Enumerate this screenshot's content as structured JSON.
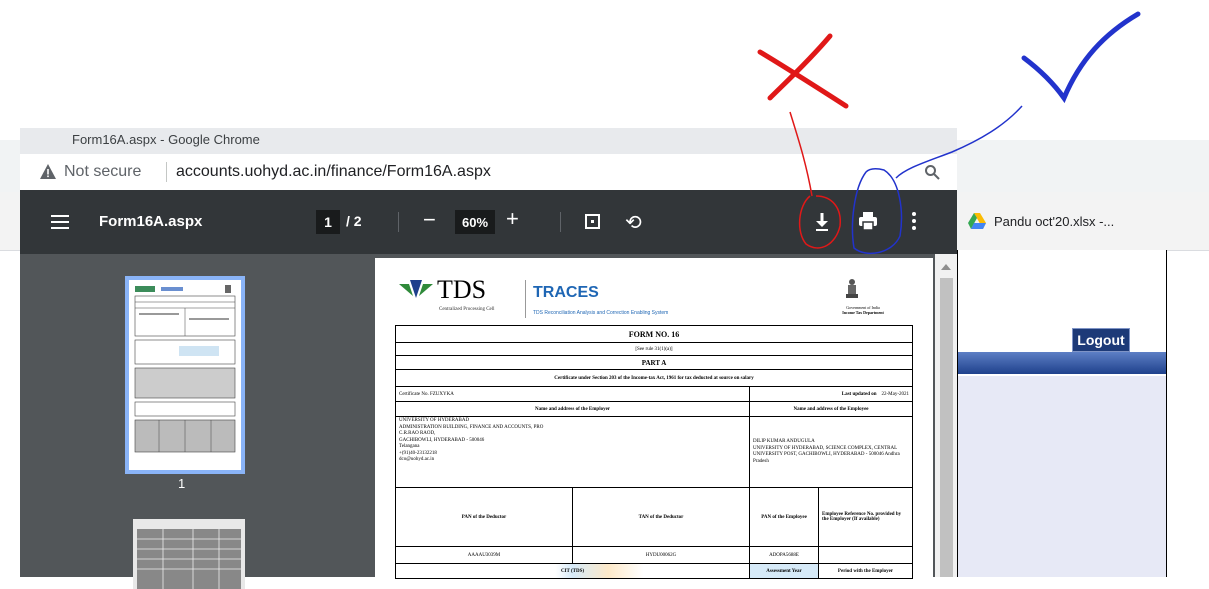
{
  "popup": {
    "window_title": "Form16A.aspx - Google Chrome",
    "not_secure": "Not secure",
    "url": "accounts.uohyd.ac.in/finance/Form16A.aspx"
  },
  "pdf_toolbar": {
    "title": "Form16A.aspx",
    "current_page": "1",
    "total_pages": "/ 2",
    "zoom": "60%"
  },
  "sidebar": {
    "thumb_number": "1"
  },
  "background": {
    "bookmark": "Pandu oct'20.xlsx -...",
    "logout": "Logout"
  },
  "doc": {
    "tds": "TDS",
    "tds_sub": "Centralized Processing Cell",
    "traces": "TRACES",
    "traces_sub": "TDS Reconciliation Analysis and Correction Enabling System",
    "goi_1": "Government of India",
    "goi_2": "Income Tax Department",
    "form_no": "FORM NO. 16",
    "rule": "[See rule 31(1)(a)]",
    "part": "PART A",
    "certificate_desc": "Certificate under Section 203 of the Income-tax Act, 1961 for tax deducted at source on salary",
    "cert_no_label": "Certificate No. FZUXYKA",
    "last_updated_label": "Last updated on",
    "last_updated_value": "22-May-2021",
    "employer_header": "Name and address of the Employer",
    "employee_header": "Name and address of the Employee",
    "employer_lines": [
      "UNIVERSITY OF HYDERABAD",
      "ADMINISTRATION BUILDING, FINANCE AND ACCOUNTS, PRO",
      "C.R.RAO RAOD,",
      "GACHIBOWLI, HYDERABAD - 500046",
      "Telangana",
      "+(91)40-23132218",
      "dco@uohyd.ac.in"
    ],
    "employee_lines": [
      "DILIP KUMAR ANDUGULA",
      "UNIVERSITY OF HYDERABAD, SCIENCE COMPLEX, CENTRAL",
      "UNIVERSITY POST, GACHIBOWLI, HYDERABAD - 500046 Andhra",
      "Pradesh"
    ],
    "col_pan_deductor": "PAN of the Deductor",
    "col_tan_deductor": "TAN of the Deductor",
    "col_pan_employee": "PAN of the Employee",
    "col_emp_ref": "Employee Reference No. provided by the Employer (If available)",
    "pan_deductor": "AAAAU3039M",
    "tan_deductor": "HYDU00062G",
    "pan_employee": "ADOPA5688E",
    "cit": "CIT (TDS)",
    "assessment_year": "Assessment Year",
    "period": "Period with the Employer"
  }
}
